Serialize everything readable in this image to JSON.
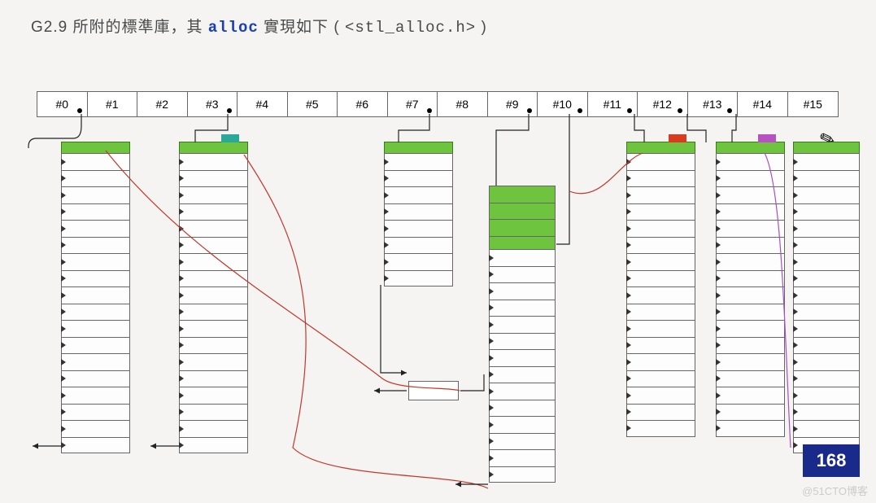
{
  "title": {
    "prefix": "G2.9 所附的標準庫，其 ",
    "keyword": "alloc",
    "mid": " 實現如下 ( ",
    "header": "<stl_alloc.h>",
    "suffix": " )"
  },
  "free_list": {
    "slots": [
      "#0",
      "#1",
      "#2",
      "#3",
      "#4",
      "#5",
      "#6",
      "#7",
      "#8",
      "#9",
      "#10",
      "#11",
      "#12",
      "#13",
      "#14",
      "#15"
    ],
    "with_dot": [
      0,
      3,
      7,
      9,
      10,
      11,
      12,
      13
    ]
  },
  "columns": {
    "c0": {
      "header": true,
      "tab": null,
      "cells": 18,
      "green_cells": []
    },
    "c3": {
      "header": true,
      "tab": "teal",
      "cells": 18,
      "green_cells": []
    },
    "c7": {
      "header": true,
      "tab": null,
      "cells": 8,
      "green_cells": []
    },
    "c9a": {
      "header": false,
      "tab": null,
      "cells": 4,
      "green_cells": [
        0,
        1,
        2,
        3
      ]
    },
    "c9b": {
      "header": false,
      "tab": null,
      "cells": 14,
      "green_cells": []
    },
    "c11": {
      "header": true,
      "tab": "red",
      "cells": 17,
      "green_cells": []
    },
    "c13": {
      "header": true,
      "tab": "purple",
      "cells": 17,
      "green_cells": []
    },
    "c15": {
      "header": true,
      "tab": null,
      "cells": 18,
      "green_cells": []
    }
  },
  "badge": "168",
  "watermark": "@51CTO博客"
}
